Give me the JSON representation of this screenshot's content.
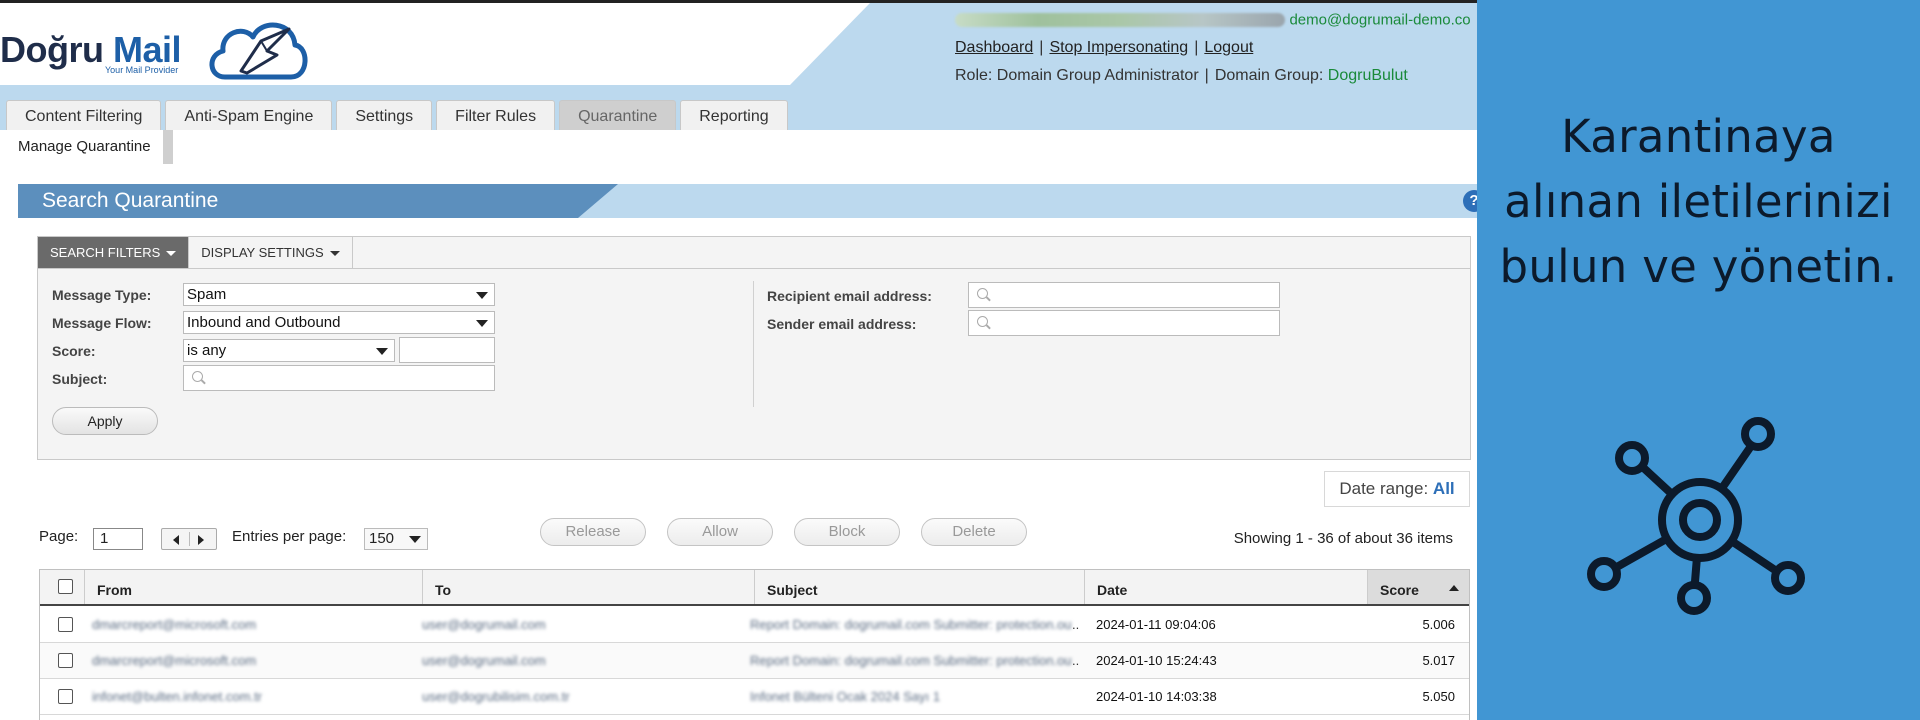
{
  "logo": {
    "part1": "Doğru",
    "part2": "Mail",
    "tagline": "Your Mail Provider"
  },
  "header": {
    "email": "demo@dogrumail-demo.co",
    "links": [
      "Dashboard",
      "Stop Impersonating",
      "Logout"
    ],
    "role_label": "Role: Domain Group Administrator",
    "group_label": "Domain Group:",
    "group_value": "DogruBulut"
  },
  "tabs": [
    {
      "label": "Content Filtering"
    },
    {
      "label": "Anti-Spam Engine"
    },
    {
      "label": "Settings"
    },
    {
      "label": "Filter Rules"
    },
    {
      "label": "Quarantine",
      "active": true
    },
    {
      "label": "Reporting"
    }
  ],
  "subtab": "Manage Quarantine",
  "search_title": "Search Quarantine",
  "help": "?",
  "filter_tabs": {
    "search_filters": "SEARCH FILTERS",
    "display_settings": "DISPLAY SETTINGS"
  },
  "filters": {
    "message_type_label": "Message Type:",
    "message_type_value": "Spam",
    "message_flow_label": "Message Flow:",
    "message_flow_value": "Inbound and Outbound",
    "score_label": "Score:",
    "score_value": "is any",
    "subject_label": "Subject:",
    "recipient_label": "Recipient email address:",
    "sender_label": "Sender email address:",
    "apply": "Apply"
  },
  "date_range": {
    "label": "Date range:",
    "value": "All"
  },
  "pager": {
    "page_label": "Page:",
    "page_value": "1",
    "entries_label": "Entries per page:",
    "entries_value": "150",
    "showing": "Showing 1 - 36 of about 36 items"
  },
  "actions": [
    "Release",
    "Allow",
    "Block",
    "Delete"
  ],
  "table": {
    "columns": [
      "From",
      "To",
      "Subject",
      "Date",
      "Score"
    ],
    "rows": [
      {
        "from": "dmarcreport@microsoft.com",
        "to": "user@dogrumail.com",
        "subject": "Report Domain: dogrumail.com Submitter: protection.outlook",
        "date": "2024-01-11 09:04:06",
        "score": "5.006"
      },
      {
        "from": "dmarcreport@microsoft.com",
        "to": "user@dogrumail.com",
        "subject": "Report Domain: dogrumail.com Submitter: protection.outlook",
        "date": "2024-01-10 15:24:43",
        "score": "5.017"
      },
      {
        "from": "infonet@bulten.infonet.com.tr",
        "to": "user@dogrubilisim.com.tr",
        "subject": "Infonet Bülteni Ocak 2024 Sayı 1",
        "date": "2024-01-10 14:03:38",
        "score": "5.050"
      }
    ]
  },
  "side": {
    "text": "Karantinaya alınan iletilerinizi bulun ve yönetin.",
    "icon": "network-hub-icon",
    "bg_color": "#4196d3"
  }
}
